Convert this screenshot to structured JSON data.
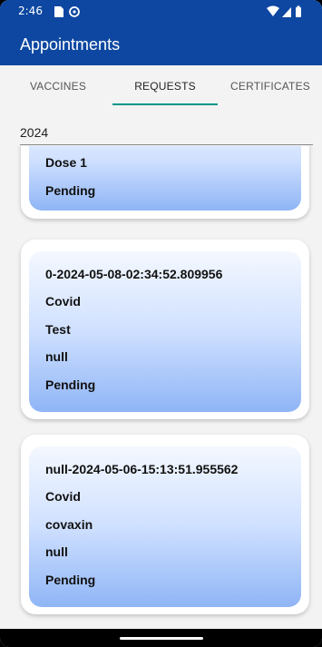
{
  "status_bar": {
    "time": "2:46",
    "left_icons": [
      "sim-card-icon",
      "sync-icon"
    ],
    "right_icons": [
      "wifi-icon",
      "signal-icon",
      "battery-icon"
    ]
  },
  "app_bar": {
    "title": "Appointments"
  },
  "tabs": [
    {
      "label": "VACCINES",
      "active": false
    },
    {
      "label": "REQUESTS",
      "active": true
    },
    {
      "label": "CERTIFICATES",
      "active": false
    }
  ],
  "filter": {
    "value": "2024"
  },
  "requests": [
    {
      "lines": [
        "Dose 1",
        "Pending"
      ]
    },
    {
      "lines": [
        "0-2024-05-08-02:34:52.809956",
        "Covid",
        "Test",
        "null",
        "Pending"
      ]
    },
    {
      "lines": [
        "null-2024-05-06-15:13:51.955562",
        "Covid",
        "covaxin",
        "null",
        "Pending"
      ]
    }
  ],
  "colors": {
    "app_bar": "#0d47a1",
    "tab_indicator": "#009688",
    "card_gradient_top": "#f4f8ff",
    "card_gradient_bottom": "#8fb5f6"
  }
}
